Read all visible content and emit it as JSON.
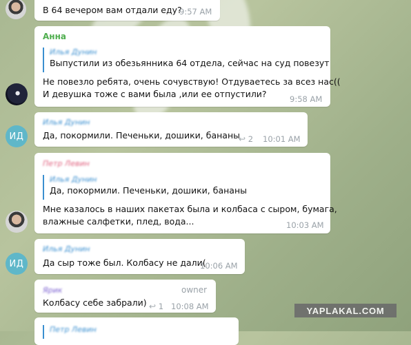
{
  "messages": [
    {
      "text": "В 64 вечером вам отдали еду?",
      "time": "9:57 AM"
    },
    {
      "sender": "Анна",
      "sender_color": "#4fae4e",
      "quote_author": "Илья Дунин",
      "quote_text": "Выпустили из обезьянника 64 отдела, сейчас на суд повезут",
      "line1": "Не повезло ребята, очень сочувствую! Отдуваетесь за всез нас((",
      "line2": "И девушка тоже с вами была ,или ее отпустили?",
      "time": "9:58 AM"
    },
    {
      "sender": "Илья Дунин",
      "avatar_initials": "ИД",
      "text": "Да, покормили. Печеньки, дошики, бананы",
      "replies": "2",
      "time": "10:01 AM"
    },
    {
      "sender": "Петр Левин",
      "sender_color": "#e0607e",
      "quote_author": "Илья Дунин",
      "quote_text": "Да, покормили. Печеньки, дошики, бананы",
      "line1": "Мне казалось в наших пакетах была и колбаса с сыром, бумага,",
      "line2": "влажные салфетки, плед, вода...",
      "time": "10:03 AM"
    },
    {
      "sender": "Илья Дунин",
      "avatar_initials": "ИД",
      "text": "Да сыр тоже был. Колбасу не дали(",
      "time": "10:06 AM"
    },
    {
      "sender": "Ярик",
      "sender_color": "#7a5fd0",
      "badge": "owner",
      "text": "Колбасу себе забрали)",
      "replies": "1",
      "time": "10:08 AM"
    },
    {
      "sender": "Петр Левин"
    }
  ],
  "watermark": "YAPLAKAL.COM"
}
